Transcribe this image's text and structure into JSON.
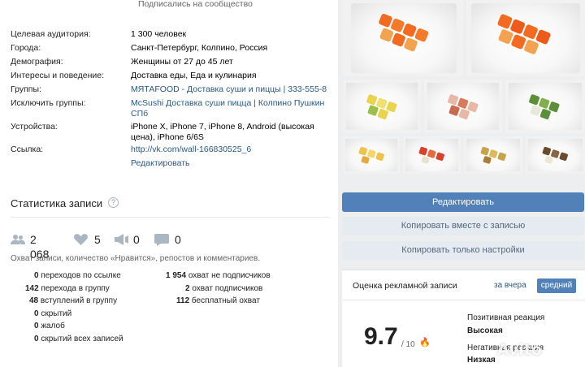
{
  "top_note": "Подписались на сообщество",
  "targeting": [
    {
      "label": "Целевая аудитория:",
      "value": "1 300 человек",
      "link": false
    },
    {
      "label": "Города:",
      "value": "Санкт-Петербург, Колпино, Россия",
      "link": false
    },
    {
      "label": "Демография:",
      "value": "Женщины от 27 до 45 лет",
      "link": false
    },
    {
      "label": "Интересы и поведение:",
      "value": "Доставка еды, Еда и кулинария",
      "link": false
    },
    {
      "label": "Группы:",
      "value": "МЯТАFOOD - Доставка суши и пиццы | 333-555-8",
      "link": true
    },
    {
      "label": "Исключить группы:",
      "value": "McSushi Доставка суши пицца | Колпино Пушкин СПб",
      "link": true
    },
    {
      "label": "Устройства:",
      "value": "iPhone X, iPhone 7, iPhone 8, Android (высокая цена), iPhone 6/6S",
      "link": false
    },
    {
      "label": "Ссылка:",
      "value": "http://vk.com/wall-166830525_6",
      "link": true
    },
    {
      "label": "",
      "value": "Редактировать",
      "link": true
    }
  ],
  "stats": {
    "title": "Статистика записи",
    "help": "?",
    "reach": "2 068",
    "likes": "5",
    "reposts": "0",
    "comments": "0",
    "note": "Охват записи, количество «Нравится», репостов и комментариев.",
    "left_col": [
      {
        "num": "0",
        "text": "переходов по ссылке"
      },
      {
        "num": "142",
        "text": "перехода в группу"
      },
      {
        "num": "48",
        "text": "вступлений в группу"
      },
      {
        "num": "0",
        "text": "скрытий"
      },
      {
        "num": "0",
        "text": "жалоб"
      },
      {
        "num": "0",
        "text": "скрытий всех записей"
      }
    ],
    "right_col": [
      {
        "num": "1 954",
        "text": "охват не подписчиков"
      },
      {
        "num": "2",
        "text": "охват подписчиков"
      },
      {
        "num": "112",
        "text": "бесплатный охват"
      }
    ]
  },
  "buttons": {
    "edit": "Редактировать",
    "copy_with_post": "Копировать вместе с записью",
    "copy_settings": "Копировать только настройки"
  },
  "rating": {
    "title": "Оценка рекламной записи",
    "period": "за вчера",
    "mode": "средний",
    "score": "9.7",
    "of": "/ 10",
    "positive_label": "Позитивная реакция",
    "positive_value": "Высокая",
    "negative_label": "Негативная реакция",
    "negative_value": "Низкая"
  },
  "watermark": "Avito",
  "colors": {
    "accent": "#5181b8",
    "link": "#2a5885"
  }
}
